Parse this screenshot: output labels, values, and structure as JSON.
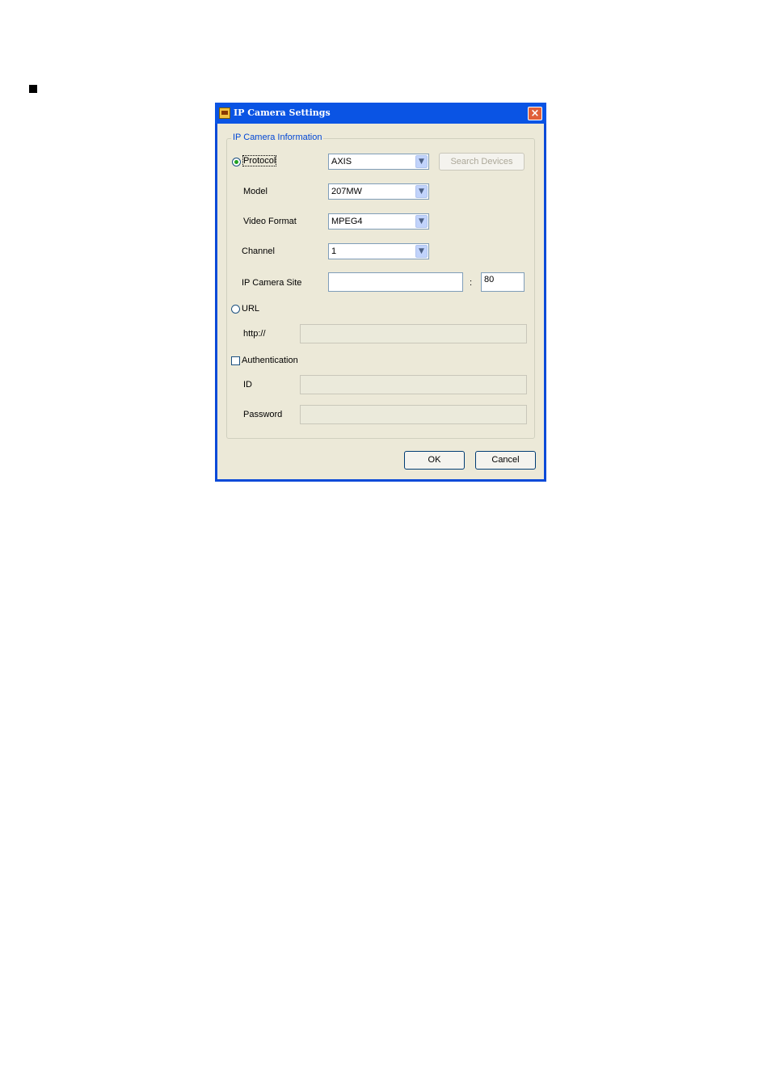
{
  "window": {
    "title": "IP Camera Settings",
    "close_icon": "×"
  },
  "group": {
    "title": "IP Camera Information"
  },
  "protocol": {
    "label": "Protocol",
    "value": "AXIS",
    "selected": true
  },
  "search_button": {
    "label": "Search Devices"
  },
  "model": {
    "label": "Model",
    "value": "207MW"
  },
  "video_format": {
    "label": "Video Format",
    "value": "MPEG4"
  },
  "channel": {
    "label": "Channel",
    "value": "1"
  },
  "ip_site": {
    "label": "IP Camera Site",
    "value": "",
    "separator": ":",
    "port": "80"
  },
  "url": {
    "label": "URL",
    "selected": false,
    "prefix": "http://",
    "value": ""
  },
  "auth": {
    "label": "Authentication",
    "checked": false
  },
  "id": {
    "label": "ID",
    "value": ""
  },
  "password": {
    "label": "Password",
    "value": ""
  },
  "buttons": {
    "ok": "OK",
    "cancel": "Cancel"
  },
  "dropdown_arrow": "▼"
}
